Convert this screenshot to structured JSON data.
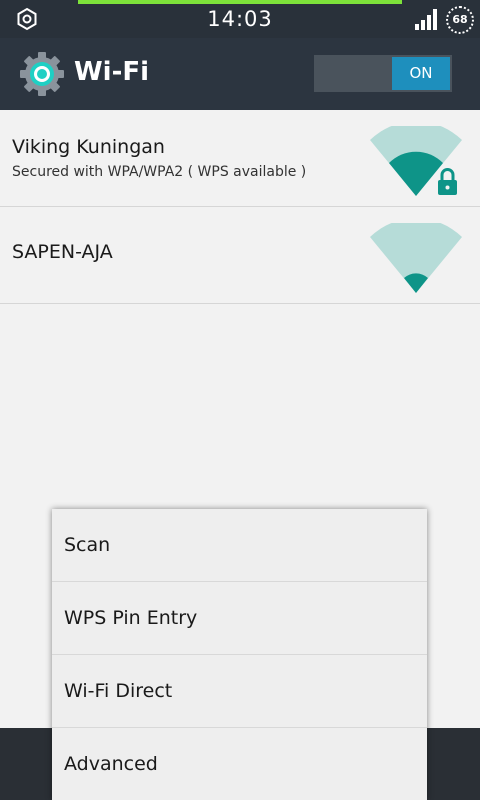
{
  "status_bar": {
    "time": "14:03",
    "battery": "68",
    "left_icon": "settings-icon",
    "signal_icon": "signal-icon"
  },
  "action_bar": {
    "title": "Wi-Fi",
    "icon": "wifi-settings-gear-icon",
    "toggle_label": "ON"
  },
  "networks": [
    {
      "name": "Viking Kuningan",
      "status": "Secured with WPA/WPA2 ( WPS available )",
      "secured": true
    },
    {
      "name": "SAPEN-AJA",
      "status": "",
      "secured": false
    }
  ],
  "menu": {
    "items": [
      {
        "label": "Scan"
      },
      {
        "label": "WPS Pin Entry"
      },
      {
        "label": "Wi-Fi Direct"
      },
      {
        "label": "Advanced"
      }
    ]
  },
  "colors": {
    "accent": "#0e9488",
    "accent_light": "#b6dcd8",
    "toggle_on": "#1e8fbd",
    "action_bar": "#2c3540",
    "status_bar": "#29313a",
    "progress": "#7de23a"
  }
}
